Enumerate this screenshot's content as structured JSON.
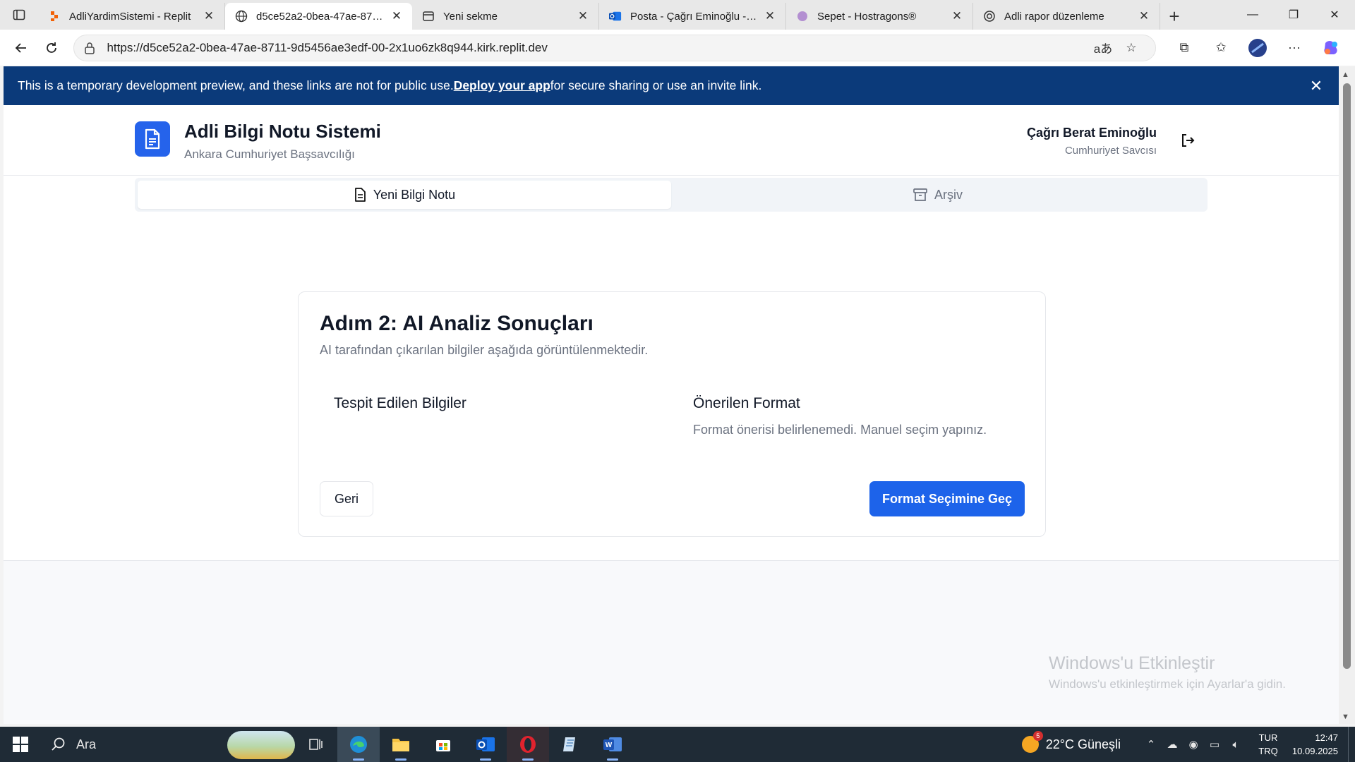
{
  "browser": {
    "tabs": [
      {
        "title": "AdliYardimSistemi - Replit",
        "icon": "replit-icon",
        "active": false
      },
      {
        "title": "d5ce52a2-0bea-47ae-8711-9d5456ae3edf-00-2x1uo6zk8q944.kirk.replit.dev",
        "icon": "globe-icon",
        "active": true
      },
      {
        "title": "Yeni sekme",
        "icon": "newtab-icon",
        "active": false
      },
      {
        "title": "Posta - Çağrı Eminoğlu - Outlook",
        "icon": "outlook-icon",
        "active": false
      },
      {
        "title": "Sepet - Hostragons®",
        "icon": "hostragons-icon",
        "active": false
      },
      {
        "title": "Adli rapor düzenleme",
        "icon": "openai-icon",
        "active": false
      }
    ],
    "url": "https://d5ce52a2-0bea-47ae-8711-9d5456ae3edf-00-2x1uo6zk8q944.kirk.replit.dev"
  },
  "banner": {
    "text_before": "This is a temporary development preview, and these links are not for public use. ",
    "link": "Deploy your app",
    "text_after": " for secure sharing or use an invite link."
  },
  "header": {
    "title": "Adli Bilgi Notu Sistemi",
    "subtitle": "Ankara Cumhuriyet Başsavcılığı",
    "user_name": "Çağrı Berat Eminoğlu",
    "user_role": "Cumhuriyet Savcısı"
  },
  "nav_tabs": [
    {
      "label": "Yeni Bilgi Notu",
      "icon": "document-icon",
      "active": true
    },
    {
      "label": "Arşiv",
      "icon": "archive-icon",
      "active": false
    }
  ],
  "card": {
    "title": "Adım 2: AI Analiz Sonuçları",
    "description": "AI tarafından çıkarılan bilgiler aşağıda görüntülenmektedir.",
    "detected_heading": "Tespit Edilen Bilgiler",
    "format_heading": "Önerilen Format",
    "format_text": "Format önerisi belirlenemedi. Manuel seçim yapınız.",
    "back_label": "Geri",
    "next_label": "Format Seçimine Geç"
  },
  "watermark": {
    "title": "Windows'u Etkinleştir",
    "subtitle": "Windows'u etkinleştirmek için Ayarlar'a gidin."
  },
  "taskbar": {
    "search_placeholder": "Ara",
    "weather": "22°C  Güneşli",
    "weather_badge": "5",
    "lang_top": "TUR",
    "lang_bottom": "TRQ",
    "time": "12:47",
    "date": "10.09.2025"
  },
  "colors": {
    "banner": "#0b3a7a",
    "primary": "#1d63ea",
    "taskbar": "#1f2b36"
  }
}
